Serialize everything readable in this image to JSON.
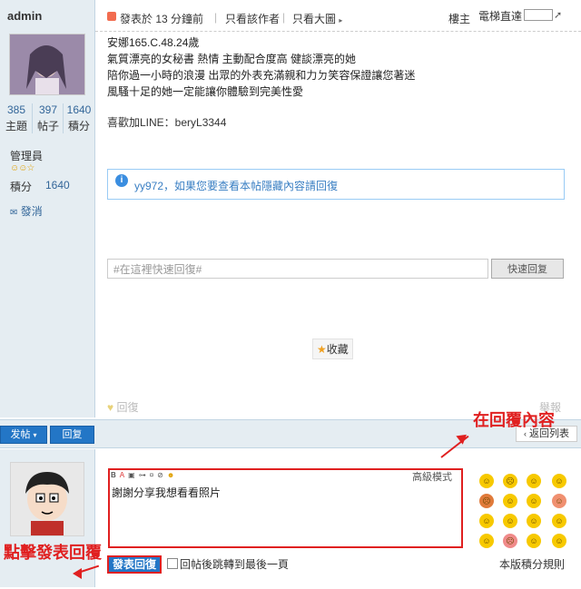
{
  "author": {
    "name": "admin",
    "stats": [
      {
        "value": "385",
        "label": "主題"
      },
      {
        "value": "397",
        "label": "帖子"
      },
      {
        "value": "1640",
        "label": "積分"
      }
    ],
    "role": "管理員",
    "score_label": "積分",
    "score_value": "1640",
    "message_link": "發消"
  },
  "post_header": {
    "posted": "發表於 13 分鐘前",
    "only_author": "只看該作者",
    "only_big": "只看大圖",
    "floor": "樓主",
    "jump_label": "電梯直達"
  },
  "post_body": {
    "lines": [
      "安娜165.C.48.24歲",
      "氣質漂亮的女秘書 熱情 主動配合度高 健談漂亮的她",
      "陪你過一小時的浪漫 出眾的外表充滿親和力ㄉ笑容保證讓您著迷",
      "風騷十足的她一定能讓你體驗到完美性愛"
    ],
    "contact": "喜歡加LINE：beryL3344"
  },
  "hidden_notice": "yy972，如果您要查看本帖隱藏內容請回復",
  "quick_reply": {
    "placeholder": "#在這裡快速回復#",
    "button": "快速回复"
  },
  "favorite": "收藏",
  "reply_link": "回復",
  "report_link": "舉報",
  "actions": {
    "post": "发帖",
    "reply": "回复",
    "back_list": "返回列表"
  },
  "editor": {
    "advanced": "高級模式",
    "content": "謝謝分享我想看看照片"
  },
  "submit": "發表回復",
  "jump_last": "回帖後跳轉到最後一頁",
  "rules": "本版積分規則",
  "annotations": {
    "reply_content": "在回覆內容",
    "click_submit": "點擊發表回覆"
  },
  "colors": {
    "accent": "#2376c6",
    "highlight": "#e02020",
    "sidebar": "#e5edf2"
  }
}
